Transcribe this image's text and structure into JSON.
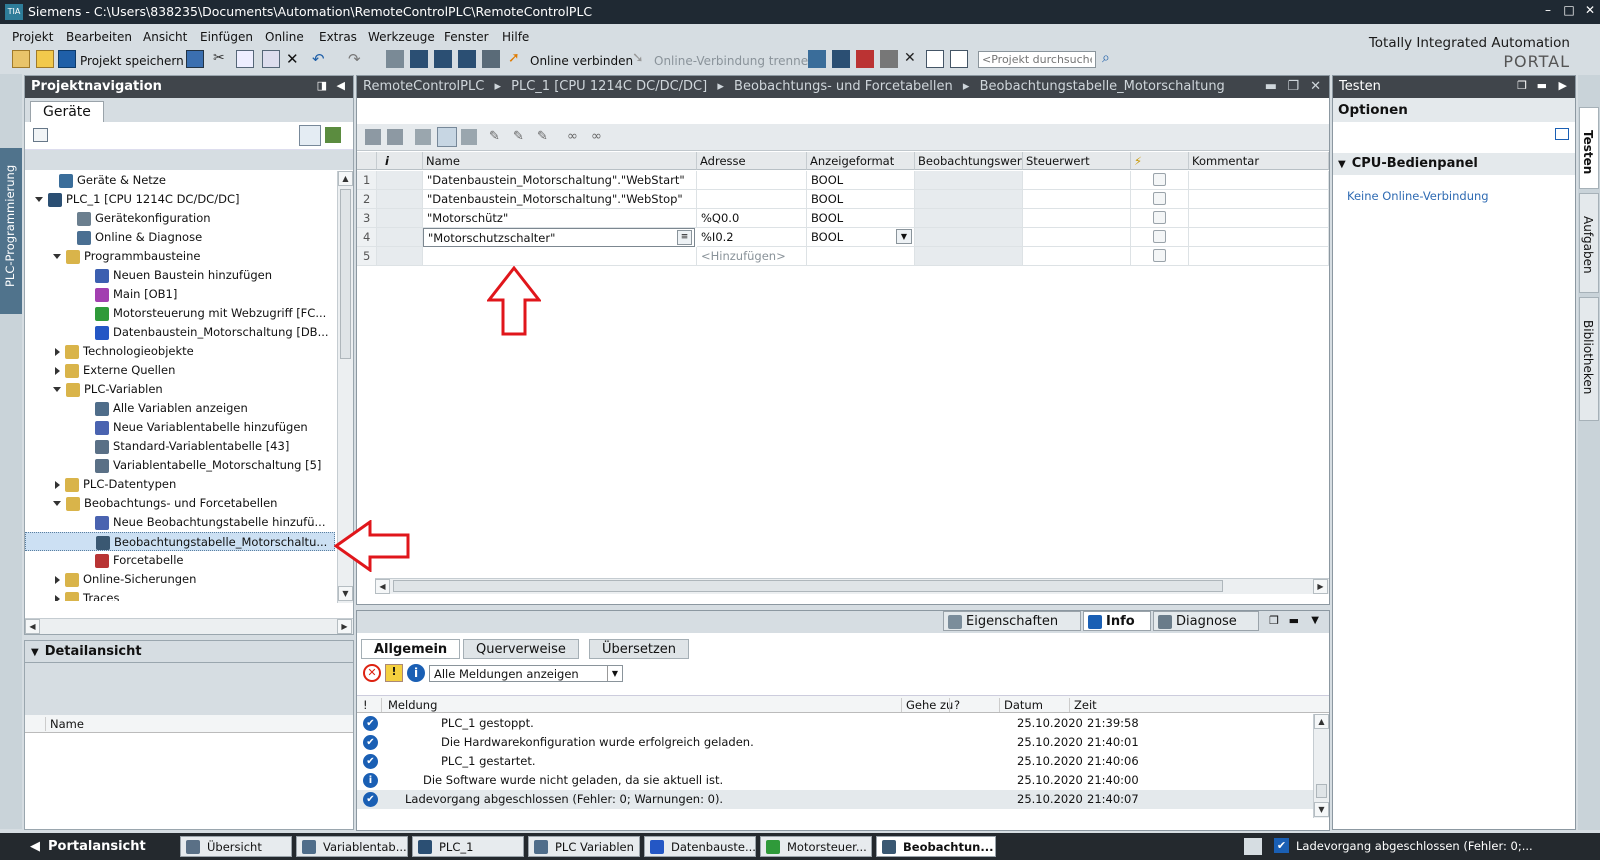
{
  "window": {
    "title": "Siemens  -  C:\\Users\\838235\\Documents\\Automation\\RemoteControlPLC\\RemoteControlPLC",
    "logo": "TIA"
  },
  "menu": [
    "Projekt",
    "Bearbeiten",
    "Ansicht",
    "Einfügen",
    "Online",
    "Extras",
    "Werkzeuge",
    "Fenster",
    "Hilfe"
  ],
  "toolbar": {
    "save_label": "Projekt speichern",
    "online_connect": "Online verbinden",
    "online_disconnect": "Online-Verbindung trennen",
    "search_placeholder": "<Projekt durchsuchen>"
  },
  "brand": {
    "line1": "Totally Integrated Automation",
    "line2": "PORTAL"
  },
  "left_strip_tab": "PLC-Programmierung",
  "project_nav": {
    "title": "Projektnavigation",
    "tab": "Geräte",
    "items": [
      {
        "label": "Geräte & Netze",
        "level": 0,
        "icon": "network-icon",
        "expander": "none"
      },
      {
        "label": "PLC_1 [CPU 1214C DC/DC/DC]",
        "level": 0,
        "icon": "plc-icon",
        "expander": "down"
      },
      {
        "label": "Gerätekonfiguration",
        "level": 1,
        "icon": "device-config-icon",
        "expander": "none"
      },
      {
        "label": "Online & Diagnose",
        "level": 1,
        "icon": "diagnostics-icon",
        "expander": "none"
      },
      {
        "label": "Programmbausteine",
        "level": 1,
        "icon": "folder-icon",
        "expander": "down"
      },
      {
        "label": "Neuen Baustein hinzufügen",
        "level": 2,
        "icon": "add-block-icon",
        "expander": "none"
      },
      {
        "label": "Main [OB1]",
        "level": 2,
        "icon": "ob-block-icon",
        "expander": "none"
      },
      {
        "label": "Motorsteuerung mit Webzugriff [FC...",
        "level": 2,
        "icon": "fc-block-icon",
        "expander": "none"
      },
      {
        "label": "Datenbaustein_Motorschaltung [DB...",
        "level": 2,
        "icon": "db-block-icon",
        "expander": "none"
      },
      {
        "label": "Technologieobjekte",
        "level": 1,
        "icon": "folder-icon",
        "expander": "right"
      },
      {
        "label": "Externe Quellen",
        "level": 1,
        "icon": "folder-icon",
        "expander": "right"
      },
      {
        "label": "PLC-Variablen",
        "level": 1,
        "icon": "folder-icon",
        "expander": "down"
      },
      {
        "label": "Alle Variablen anzeigen",
        "level": 2,
        "icon": "variables-icon",
        "expander": "none"
      },
      {
        "label": "Neue Variablentabelle hinzufügen",
        "level": 2,
        "icon": "add-table-icon",
        "expander": "none"
      },
      {
        "label": "Standard-Variablentabelle [43]",
        "level": 2,
        "icon": "table-icon",
        "expander": "none"
      },
      {
        "label": "Variablentabelle_Motorschaltung [5]",
        "level": 2,
        "icon": "table-icon",
        "expander": "none"
      },
      {
        "label": "PLC-Datentypen",
        "level": 1,
        "icon": "folder-icon",
        "expander": "right"
      },
      {
        "label": "Beobachtungs- und Forcetabellen",
        "level": 1,
        "icon": "folder-icon",
        "expander": "down"
      },
      {
        "label": "Neue Beobachtungstabelle hinzufü...",
        "level": 2,
        "icon": "add-watch-table-icon",
        "expander": "none"
      },
      {
        "label": "Beobachtungstabelle_Motorschaltu...",
        "level": 2,
        "icon": "watch-table-icon",
        "expander": "none",
        "selected": true
      },
      {
        "label": "Forcetabelle",
        "level": 2,
        "icon": "force-table-icon",
        "expander": "none"
      },
      {
        "label": "Online-Sicherungen",
        "level": 1,
        "icon": "folder-icon",
        "expander": "right"
      },
      {
        "label": "Traces",
        "level": 1,
        "icon": "folder-icon",
        "expander": "right"
      }
    ]
  },
  "detail": {
    "title": "Detailansicht",
    "column": "Name"
  },
  "editor": {
    "breadcrumb": [
      "RemoteControlPLC",
      "PLC_1 [CPU 1214C DC/DC/DC]",
      "Beobachtungs- und Forcetabellen",
      "Beobachtungstabelle_Motorschaltung"
    ],
    "columns": [
      "i",
      "Name",
      "Adresse",
      "Anzeigeformat",
      "Beobachtungswert",
      "Steuerwert",
      "⚡",
      "Kommentar"
    ],
    "rows": [
      {
        "num": "1",
        "name": "\"Datenbaustein_Motorschaltung\".\"WebStart\"",
        "address": "",
        "format": "BOOL"
      },
      {
        "num": "2",
        "name": "\"Datenbaustein_Motorschaltung\".\"WebStop\"",
        "address": "",
        "format": "BOOL"
      },
      {
        "num": "3",
        "name": "\"Motorschütz\"",
        "address": "%Q0.0",
        "format": "BOOL"
      },
      {
        "num": "4",
        "name": "\"Motorschutzschalter\"",
        "address": "%I0.2",
        "format": "BOOL"
      },
      {
        "num": "5",
        "name": "",
        "address": "<Hinzufügen>",
        "format": ""
      }
    ]
  },
  "inspector": {
    "tabs": [
      "Eigenschaften",
      "Info",
      "Diagnose"
    ],
    "subtabs": [
      "Allgemein",
      "Querverweise",
      "Übersetzen"
    ],
    "filter": "Alle Meldungen anzeigen",
    "columns": [
      "!",
      "Meldung",
      "Gehe zu",
      "?",
      "Datum",
      "Zeit"
    ],
    "messages": [
      {
        "icon": "check",
        "text": "PLC_1 gestoppt.",
        "indent": 3,
        "date": "25.10.2020",
        "time": "21:39:58"
      },
      {
        "icon": "check",
        "text": "Die Hardwarekonfiguration wurde erfolgreich geladen.",
        "indent": 3,
        "date": "25.10.2020",
        "time": "21:40:01"
      },
      {
        "icon": "check",
        "text": "PLC_1 gestartet.",
        "indent": 3,
        "date": "25.10.2020",
        "time": "21:40:06"
      },
      {
        "icon": "info",
        "text": "Die Software wurde nicht geladen, da sie aktuell ist.",
        "indent": 2,
        "date": "25.10.2020",
        "time": "21:40:00"
      },
      {
        "icon": "check",
        "text": "Ladevorgang abgeschlossen (Fehler: 0; Warnungen: 0).",
        "indent": 1,
        "date": "25.10.2020",
        "time": "21:40:07"
      }
    ]
  },
  "right_panel": {
    "title": "Testen",
    "options": "Optionen",
    "section": "CPU-Bedienpanel",
    "status": "Keine Online-Verbindung"
  },
  "right_tabs": [
    "Testen",
    "Aufgaben",
    "Bibliotheken"
  ],
  "taskbar": {
    "portal": "Portalansicht",
    "items": [
      "Übersicht",
      "Variablentab...",
      "PLC_1",
      "PLC Variablen",
      "Datenbauste...",
      "Motorsteuer...",
      "Beobachtun..."
    ],
    "status": "Ladevorgang abgeschlossen (Fehler: 0;..."
  }
}
